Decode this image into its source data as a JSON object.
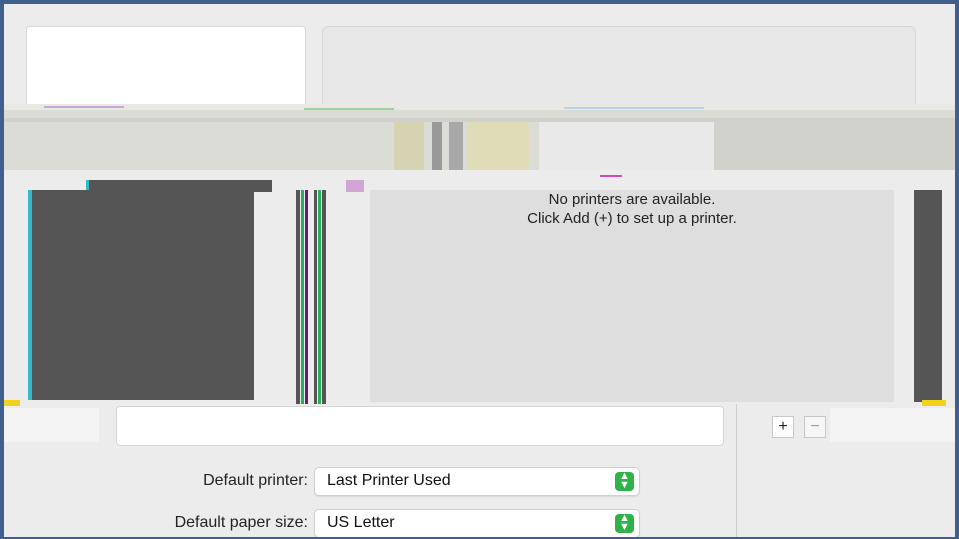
{
  "printers_pane": {
    "empty_title": "No printers are available.",
    "empty_hint": "Click Add (+) to set up a printer."
  },
  "toolbar": {
    "add_label": "+",
    "remove_label": "−"
  },
  "settings": {
    "default_printer": {
      "label": "Default printer:",
      "value": "Last Printer Used"
    },
    "default_paper_size": {
      "label": "Default paper size:",
      "value": "US Letter"
    }
  },
  "icons": {
    "stepper": "up-down-stepper-icon"
  },
  "colors": {
    "frame_border": "#3f5f8f",
    "stepper_accent": "#2fb24a",
    "panel_bg": "#ececec"
  }
}
